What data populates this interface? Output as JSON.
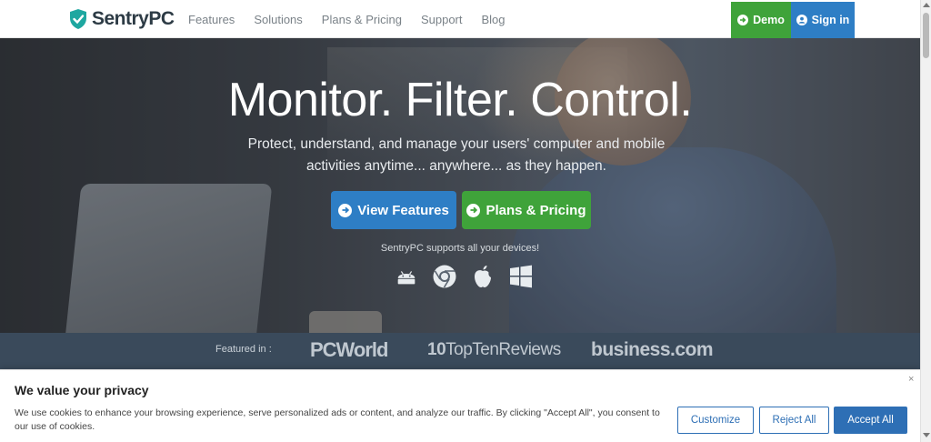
{
  "nav": {
    "brand": "SentryPC",
    "links": [
      "Features",
      "Solutions",
      "Plans & Pricing",
      "Support",
      "Blog"
    ],
    "demo_label": "Demo",
    "signin_label": "Sign in"
  },
  "hero": {
    "title": "Monitor. Filter. Control.",
    "subtitle": "Protect, understand, and manage your users' computer and mobile activities anytime... anywhere... as they happen.",
    "features_button": "View Features",
    "pricing_button": "Plans & Pricing",
    "supports_text": "SentryPC supports all your devices!",
    "devices": [
      "android-icon",
      "chrome-icon",
      "apple-icon",
      "windows-icon"
    ]
  },
  "featured": {
    "label": "Featured in :",
    "logos": [
      "PCWorld",
      "TopTenReviews",
      "business.com"
    ]
  },
  "cookie": {
    "title": "We value your privacy",
    "text": "We use cookies to enhance your browsing experience, serve personalized ads or content, and analyze our traffic. By clicking \"Accept All\", you consent to our use of cookies.",
    "close": "×",
    "customize": "Customize",
    "reject": "Reject All",
    "accept": "Accept All"
  },
  "colors": {
    "green": "#3fa33a",
    "blue": "#2e7ec5",
    "cookie_blue": "#2e6fb5"
  }
}
